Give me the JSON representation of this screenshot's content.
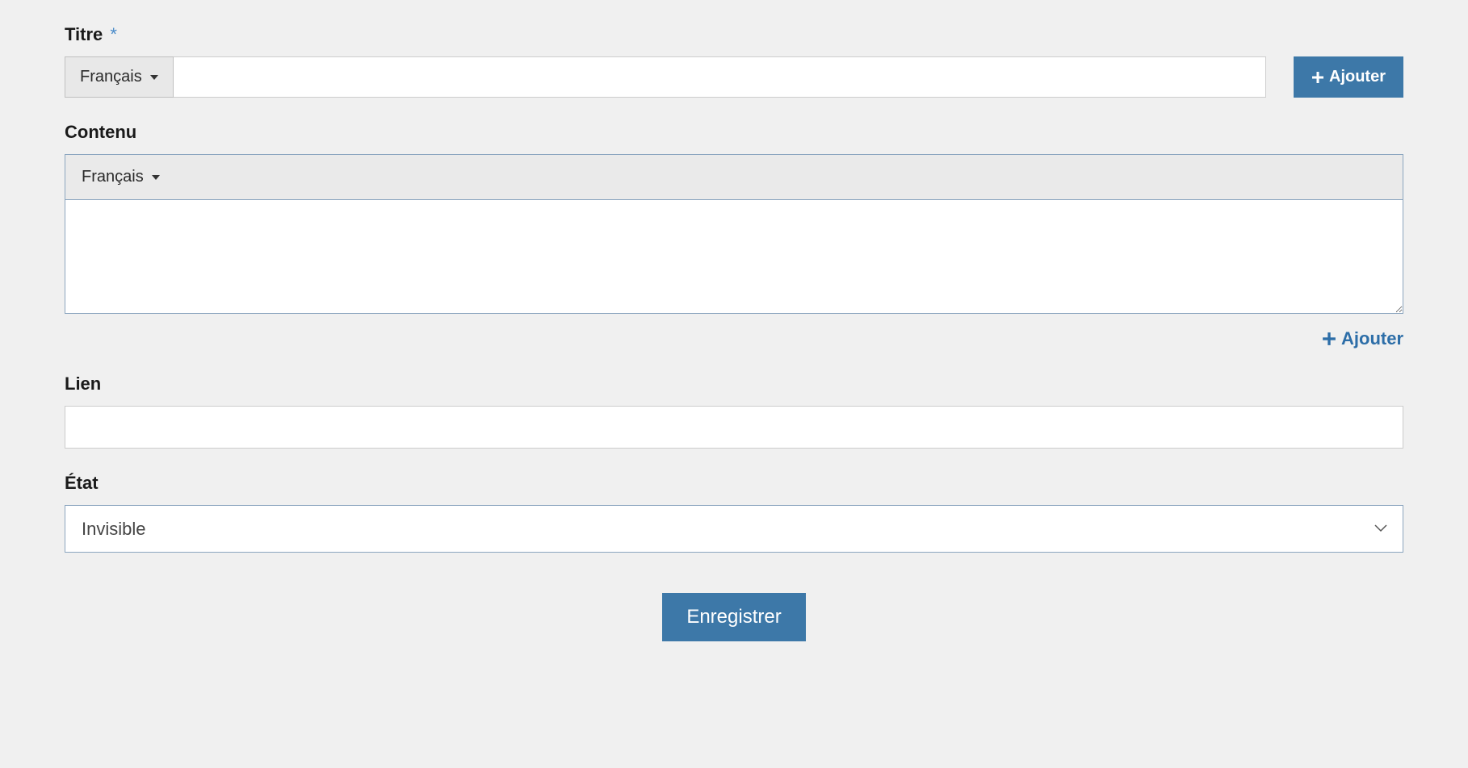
{
  "titre": {
    "label": "Titre",
    "required_marker": "*",
    "language": "Français",
    "value": "",
    "add_button_label": "Ajouter"
  },
  "contenu": {
    "label": "Contenu",
    "language": "Français",
    "value": "",
    "add_link_label": "Ajouter"
  },
  "lien": {
    "label": "Lien",
    "value": ""
  },
  "etat": {
    "label": "État",
    "selected": "Invisible"
  },
  "submit": {
    "label": "Enregistrer"
  }
}
